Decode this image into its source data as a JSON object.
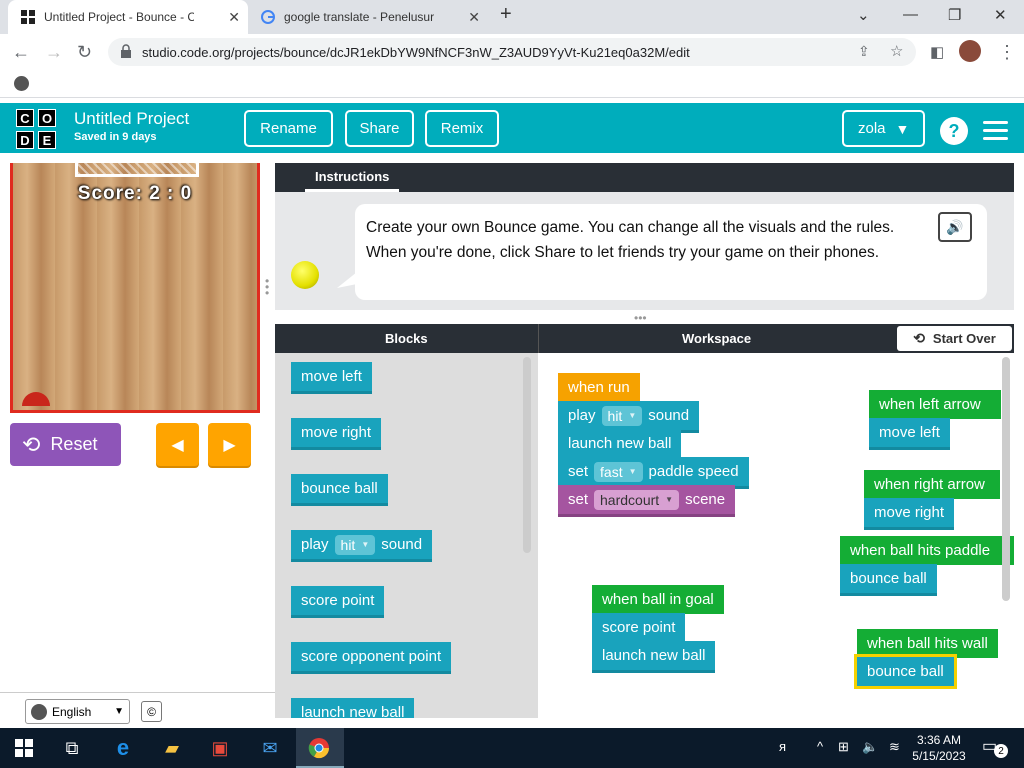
{
  "browser": {
    "tabs": [
      {
        "title": "Untitled Project - Bounce - C",
        "active": true
      },
      {
        "title": "google translate - Penelusuran G",
        "active": false
      }
    ],
    "new_tab_label": "+",
    "url": "studio.code.org/projects/bounce/dcJR1ekDbYW9NfNCF3nW_Z3AUD9YyVt-Ku21eq0a32M/edit"
  },
  "header": {
    "logo_letters": [
      "C",
      "O",
      "D",
      "E"
    ],
    "project_title": "Untitled Project",
    "saved_text": "Saved in 9 days",
    "buttons": {
      "rename": "Rename",
      "share": "Share",
      "remix": "Remix"
    },
    "user": "zola",
    "help": "?"
  },
  "game": {
    "score": "Score: 2 : 0",
    "reset_label": "Reset",
    "left_arrow": "◀",
    "right_arrow": "▶"
  },
  "footer": {
    "language": "English",
    "cc": "©"
  },
  "instructions": {
    "tab": "Instructions",
    "text": "Create your own Bounce game. You can change all the visuals and the rules. When you're done, click Share to let friends try your game on their phones."
  },
  "workspace_header": {
    "blocks": "Blocks",
    "workspace": "Workspace",
    "start_over": "Start Over"
  },
  "toolbox_blocks": [
    {
      "text": "move left"
    },
    {
      "text": "move right"
    },
    {
      "text": "bounce ball"
    },
    {
      "pre": "play",
      "chip": "hit",
      "post": "sound"
    },
    {
      "text": "score point"
    },
    {
      "text": "score opponent point"
    },
    {
      "text": "launch new ball"
    }
  ],
  "workspace_blocks": {
    "when_run": "when run",
    "play_sound": {
      "pre": "play",
      "chip": "hit",
      "post": "sound"
    },
    "launch_new_ball": "launch new ball",
    "set_paddle": {
      "pre": "set",
      "chip": "fast",
      "post": "paddle speed"
    },
    "set_scene": {
      "pre": "set",
      "chip": "hardcourt",
      "post": "scene"
    },
    "when_left_arrow": "when left arrow",
    "move_left": "move left",
    "when_right_arrow": "when right arrow",
    "move_right": "move right",
    "when_ball_hits_paddle": "when ball hits paddle",
    "bounce_ball_1": "bounce ball",
    "when_ball_in_goal": "when ball in goal",
    "score_point": "score point",
    "launch_new_ball_2": "launch new ball",
    "when_ball_hits_wall": "when ball hits wall",
    "bounce_ball_2": "bounce ball"
  },
  "taskbar": {
    "time": "3:36 AM",
    "date": "5/15/2023",
    "notifications": "2"
  }
}
